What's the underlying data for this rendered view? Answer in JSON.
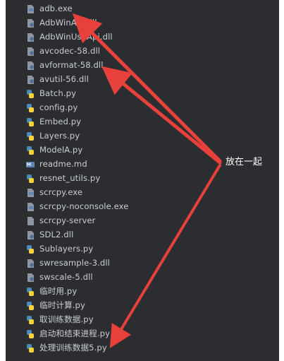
{
  "files": [
    {
      "name": "adb.exe",
      "icon": "exe-file-icon"
    },
    {
      "name": "AdbWinApi.dll",
      "icon": "dll-file-icon"
    },
    {
      "name": "AdbWinUsbApi.dll",
      "icon": "dll-file-icon"
    },
    {
      "name": "avcodec-58.dll",
      "icon": "dll-file-icon"
    },
    {
      "name": "avformat-58.dll",
      "icon": "dll-file-icon"
    },
    {
      "name": "avutil-56.dll",
      "icon": "dll-file-icon"
    },
    {
      "name": "Batch.py",
      "icon": "python-file-icon"
    },
    {
      "name": "config.py",
      "icon": "python-file-icon"
    },
    {
      "name": "Embed.py",
      "icon": "python-file-icon"
    },
    {
      "name": "Layers.py",
      "icon": "python-file-icon"
    },
    {
      "name": "ModelA.py",
      "icon": "python-file-icon"
    },
    {
      "name": "readme.md",
      "icon": "markdown-file-icon"
    },
    {
      "name": "resnet_utils.py",
      "icon": "python-file-icon"
    },
    {
      "name": "scrcpy.exe",
      "icon": "exe-file-icon"
    },
    {
      "name": "scrcpy-noconsole.exe",
      "icon": "exe-file-icon"
    },
    {
      "name": "scrcpy-server",
      "icon": "generic-file-icon"
    },
    {
      "name": "SDL2.dll",
      "icon": "dll-file-icon"
    },
    {
      "name": "Sublayers.py",
      "icon": "python-file-icon"
    },
    {
      "name": "swresample-3.dll",
      "icon": "dll-file-icon"
    },
    {
      "name": "swscale-5.dll",
      "icon": "dll-file-icon"
    },
    {
      "name": "临时用.py",
      "icon": "python-file-icon"
    },
    {
      "name": "临时计算.py",
      "icon": "python-file-icon"
    },
    {
      "name": "取训练数据.py",
      "icon": "python-file-icon"
    },
    {
      "name": "启动和结束进程.py",
      "icon": "python-file-icon"
    },
    {
      "name": "处理训练数据5.py",
      "icon": "python-file-icon"
    }
  ],
  "annotation": {
    "label": "放在一起",
    "arrow_color": "#e8403a"
  },
  "colors": {
    "background": "#2b2d30",
    "text": "#c9cdd4",
    "python_blue": "#4b8bbe",
    "python_yellow": "#ffd43b",
    "file_gray": "#8f96a3"
  }
}
